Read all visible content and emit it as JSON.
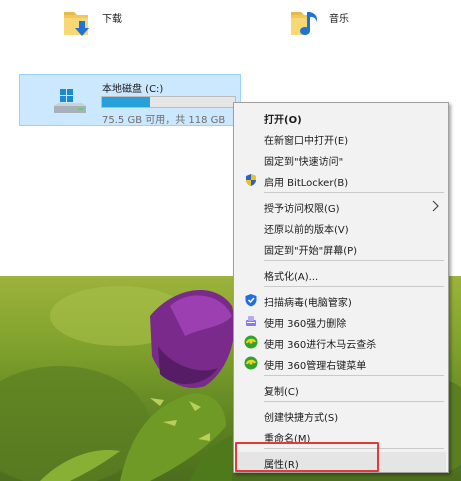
{
  "folders": [
    {
      "name": "下载",
      "icon": "download-folder-icon"
    },
    {
      "name": "音乐",
      "icon": "music-folder-icon"
    }
  ],
  "drive": {
    "title": "本地磁盘 (C:)",
    "space_text": "75.5 GB 可用，共 118 GB",
    "used_fraction": 0.36,
    "icon": "hard-drive-icon"
  },
  "context_menu": {
    "items": [
      {
        "label": "打开(O)"
      },
      {
        "label": "在新窗口中打开(E)"
      },
      {
        "label": "固定到\"快速访问\""
      },
      {
        "label": "启用 BitLocker(B)",
        "icon": "uac-shield-icon"
      },
      {
        "label": "授予访问权限(G)",
        "submenu": true
      },
      {
        "label": "还原以前的版本(V)"
      },
      {
        "label": "固定到\"开始\"屏幕(P)"
      },
      {
        "label": "格式化(A)..."
      },
      {
        "label": "扫描病毒(电脑管家)",
        "icon": "tencent-shield-icon"
      },
      {
        "label": "使用 360强力删除",
        "icon": "360-delete-icon"
      },
      {
        "label": "使用 360进行木马云查杀",
        "icon": "360-security-icon"
      },
      {
        "label": "使用 360管理右键菜单",
        "icon": "360-security-icon"
      },
      {
        "label": "复制(C)"
      },
      {
        "label": "创建快捷方式(S)"
      },
      {
        "label": "重命名(M)"
      },
      {
        "label": "属性(R)"
      }
    ]
  },
  "colors": {
    "selection_bg": "#cce8ff",
    "progress_fill": "#26a0da",
    "menu_bg": "#f2f2f2",
    "highlight_border": "#e03a3a"
  }
}
